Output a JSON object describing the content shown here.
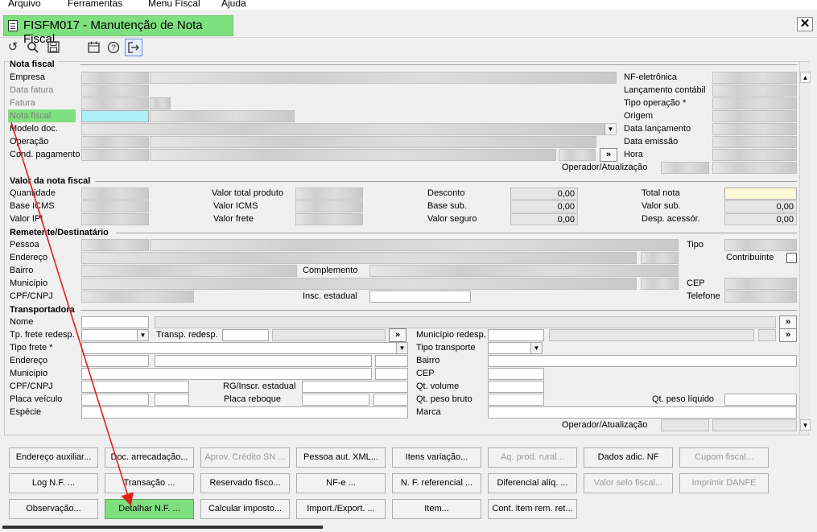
{
  "menubar": {
    "items": [
      "Arquivo",
      "Ferramentas",
      "Menu Fiscal",
      "Ajuda"
    ]
  },
  "window": {
    "title": "FISFM017 - Manutenção de Nota Fiscal",
    "close": "✕"
  },
  "toolbar": {
    "icons": [
      "undo-icon",
      "search-icon",
      "save-icon",
      "calendar-icon",
      "help-icon",
      "exit-icon"
    ]
  },
  "nota_fiscal": {
    "title": "Nota fiscal",
    "labels": {
      "empresa": "Empresa",
      "data_fatura": "Data fatura",
      "fatura": "Fatura",
      "nota_fiscal": "Nota fiscal",
      "modelo_doc": "Modelo doc.",
      "operacao": "Operação",
      "cond_pagamento": "Cond. pagamento",
      "nf_eletronica": "NF-eletrônica",
      "lancamento_contabil": "Lançamento contábil",
      "tipo_operacao": "Tipo operação *",
      "origem": "Origem",
      "data_lancamento": "Data lançamento",
      "data_emissao": "Data emissão",
      "hora": "Hora",
      "operador_atualizacao": "Operador/Atualização"
    }
  },
  "valor_nota": {
    "title": "Valor da nota fiscal",
    "labels": {
      "quantidade": "Quantidade",
      "base_icms": "Base ICMS",
      "valor_ipi": "Valor IPI",
      "valor_total_produto": "Valor total produto",
      "valor_icms": "Valor ICMS",
      "valor_frete": "Valor frete",
      "desconto": "Desconto",
      "base_sub": "Base sub.",
      "valor_seguro": "Valor seguro",
      "total_nota": "Total nota",
      "valor_sub": "Valor sub.",
      "desp_acessor": "Desp. acessór."
    },
    "values": {
      "desconto": "0,00",
      "base_sub": "0,00",
      "valor_seguro": "0,00",
      "valor_sub": "0,00",
      "desp_acessor": "0,00"
    }
  },
  "remetente": {
    "title": "Remetente/Destinatário",
    "labels": {
      "pessoa": "Pessoa",
      "endereco": "Endereço",
      "bairro": "Bairro",
      "municipio": "Município",
      "cpf_cnpj": "CPF/CNPJ",
      "complemento": "Complemento",
      "insc_estadual": "Insc. estadual",
      "tipo": "Tipo",
      "contribuinte": "Contribuinte",
      "cep": "CEP",
      "telefone": "Telefone"
    }
  },
  "transportadora": {
    "title": "Transportadora",
    "labels": {
      "nome": "Nome",
      "tp_frete_redesp": "Tp. frete redesp.",
      "transp_redesp": "Transp. redesp.",
      "municipio_redesp": "Município redesp.",
      "tipo_frete": "Tipo frete *",
      "tipo_transporte": "Tipo transporte",
      "endereco": "Endereço",
      "bairro": "Bairro",
      "municipio": "Município",
      "cep": "CEP",
      "cpf_cnpj": "CPF/CNPJ",
      "rg_inscr": "RG/Inscr. estadual",
      "qt_volume": "Qt. volume",
      "placa_veiculo": "Placa veículo",
      "placa_reboque": "Placa reboque",
      "qt_peso_bruto": "Qt. peso bruto",
      "qt_peso_liquido": "Qt. peso líquido",
      "especie": "Espécie",
      "marca": "Marca",
      "operador_atualizacao": "Operador/Atualização"
    },
    "more_button": "»"
  },
  "buttons": {
    "row1": [
      "Endereço auxiliar...",
      "Doc. arrecadação...",
      "Aprov. Crédito SN ...",
      "Pessoa aut. XML...",
      "Itens variação...",
      "Aq. prod. rural...",
      "Dados adic. NF",
      "Cupom fiscal..."
    ],
    "row2": [
      "Log N.F. ...",
      "Transação ...",
      "Reservado fisco...",
      "NF-e ...",
      "N. F. referencial ...",
      "Diferencial alíq. ...",
      "Valor selo fiscal...",
      "Imprimir DANFE"
    ],
    "row3": [
      "Observação...",
      "Detalhar N.F. ...",
      "Calcular imposto...",
      "Import./Export. ...",
      "Item...",
      "Cont. item rem. ret..."
    ]
  },
  "colors": {
    "highlight_green": "#7ee07e",
    "annotation_arrow": "#e02020"
  }
}
